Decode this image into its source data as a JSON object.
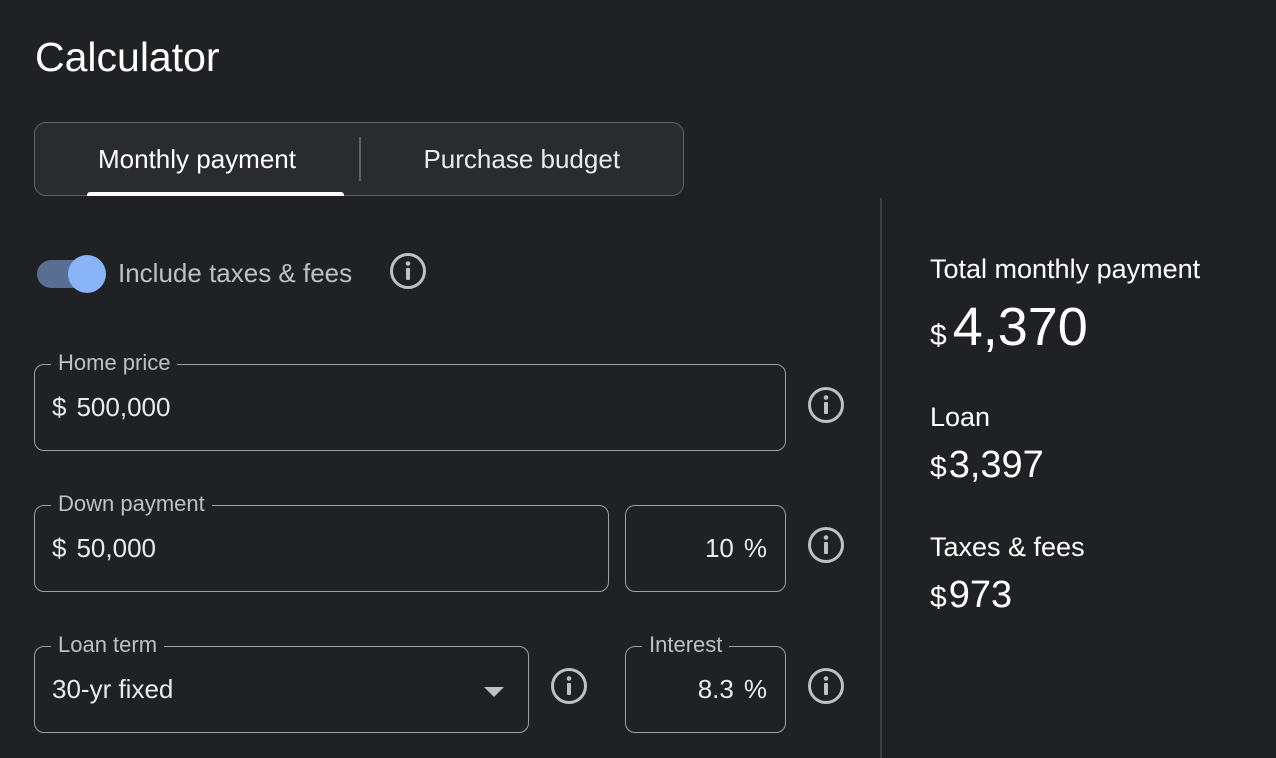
{
  "title": "Calculator",
  "tabs": [
    {
      "label": "Monthly payment",
      "active": true
    },
    {
      "label": "Purchase budget",
      "active": false
    }
  ],
  "toggle": {
    "label": "Include taxes & fees",
    "on": true
  },
  "fields": {
    "home_price": {
      "label": "Home price",
      "prefix": "$",
      "value": "500,000"
    },
    "down_payment": {
      "label": "Down payment",
      "prefix": "$",
      "value": "50,000"
    },
    "down_percent": {
      "value": "10",
      "suffix": "%"
    },
    "loan_term": {
      "label": "Loan term",
      "value": "30-yr fixed"
    },
    "interest": {
      "label": "Interest",
      "value": "8.3",
      "suffix": "%"
    }
  },
  "summary": {
    "total": {
      "label": "Total monthly payment",
      "currency": "$",
      "value": "4,370"
    },
    "loan": {
      "label": "Loan",
      "currency": "$",
      "value": "3,397"
    },
    "taxes": {
      "label": "Taxes & fees",
      "currency": "$",
      "value": "973"
    }
  },
  "colors": {
    "background": "#202124",
    "accent": "#8ab4f8",
    "outline": "#9aa0a6"
  },
  "icons": {
    "info": "info-icon",
    "dropdown": "caret-down-icon"
  }
}
